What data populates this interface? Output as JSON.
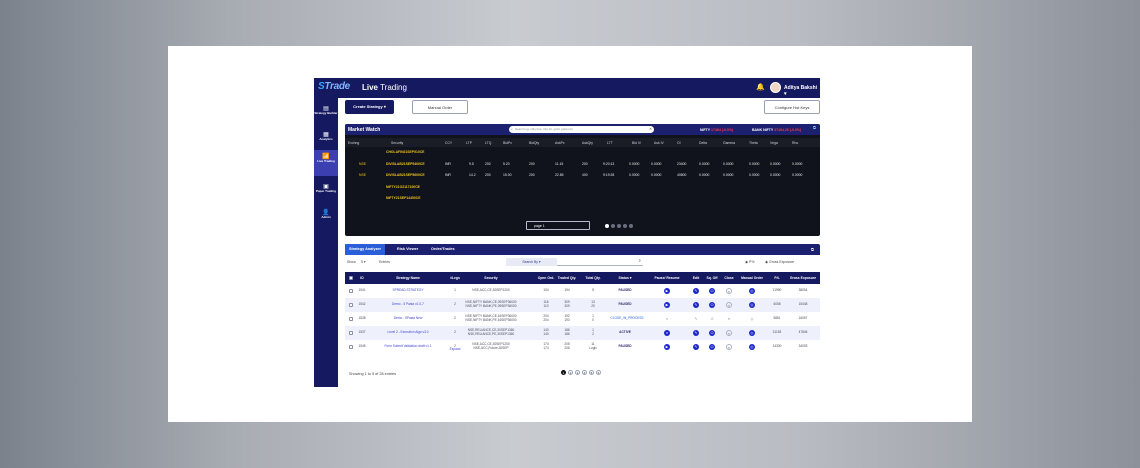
{
  "brand": {
    "logo_prefix": "S",
    "logo_rest": "Trade"
  },
  "header": {
    "title_bold": "Live",
    "title_rest": " Trading",
    "user_name": "Aditya Bakshi ▾"
  },
  "sidebar": {
    "items": [
      {
        "label": "Strategy Builder",
        "icon": "strategy-icon",
        "active": false
      },
      {
        "label": "Analytics",
        "icon": "analytics-icon",
        "active": false
      },
      {
        "label": "Live Trading",
        "icon": "live-trading-icon",
        "active": true
      },
      {
        "label": "Paper Trading",
        "icon": "paper-trading-icon",
        "active": false
      },
      {
        "label": "Admin",
        "icon": "admin-icon",
        "active": false
      }
    ]
  },
  "toolbar": {
    "create_strategy": "Create Strategy ▾",
    "manual_order": "Manual Order",
    "configure_hot_keys": "Configure Hot Keys"
  },
  "market_watch": {
    "title": "Market Watch",
    "search_placeholder": "Search eg: nifty bnk, infy fut, gold, gold mcx",
    "nifty_label": "NIFTY",
    "nifty_value": "17464 (-0.0%)",
    "banknifty_label": "BANK NIFTY",
    "banknifty_value": "37454.25 (-0.0%)",
    "columns": [
      "Exchng",
      "Security",
      "CCY",
      "LTP",
      "LTQ",
      "BidPx",
      "BidQty",
      "AskPx",
      "AskQty",
      "LTT",
      "Bid IV",
      "Ask IV",
      "OI",
      "Delta",
      "Gamma",
      "Theta",
      "Vega",
      "Rho"
    ],
    "rows": [
      {
        "exch": "",
        "security": "CHOLAFIN21SEP510CE",
        "vals": []
      },
      {
        "exch": "NSE",
        "security": "DIVISLAB21SEP5400CE",
        "vals": [
          "INR",
          "9.5",
          "200",
          "5.20",
          "200",
          "11.15",
          "200",
          "9:20:13",
          "0.0000",
          "0.0000",
          "23400",
          "0.0000",
          "0.0000",
          "0.0000",
          "0.0000",
          "0.0000"
        ]
      },
      {
        "exch": "NSE",
        "security": "DIVISLAB21SEP5600CE",
        "vals": [
          "INR",
          "14.2",
          "200",
          "15.00",
          "200",
          "22.85",
          "400",
          "9:19:28",
          "0.0000",
          "0.0000",
          "40800",
          "0.0000",
          "0.0000",
          "0.0000",
          "0.0000",
          "0.0000"
        ]
      },
      {
        "exch": "",
        "security": "NIFTY21O2117100CE",
        "vals": []
      },
      {
        "exch": "",
        "security": "NIFTY21SEP14450CE",
        "vals": []
      }
    ],
    "page_label": "page 1"
  },
  "strategy_analyzer": {
    "tabs": [
      "Strategy Analyzer",
      "Risk Viewer",
      "Order/Trades"
    ],
    "show_label": "Show",
    "show_value": "5 ▾",
    "entries_label": "Entries",
    "search_by": "Search By ▾",
    "pnl_label": "P%",
    "gross_label": "Gross Exposure",
    "columns": [
      "ID",
      "Strategy Name",
      "#Legs",
      "Security",
      "Open Ord.",
      "Traded Qty.",
      "Total Qty.",
      "Status",
      "Pause/ Resume",
      "Edit",
      "Sq. Off",
      "Close",
      "Manual Order",
      "P/L",
      "Gross Exposure"
    ],
    "rows": [
      {
        "id": "1541",
        "name": "SPREAD STRATEGY",
        "legs": "1",
        "legs_extra": "",
        "security": "NSE,ACC,CE,30SEP1200",
        "open": "104",
        "traded": "194",
        "total": "5",
        "status": "PAUSED",
        "pl": "11990",
        "gross": "38054"
      },
      {
        "id": "1542",
        "name": "Demo - 5 Pasta v1.0-7",
        "legs": "2",
        "legs_extra": "",
        "security": "NSE,NIFTY BANK,CE,09SEP36000\nNSE,NIFTY BANK,PE,09SEP36000",
        "open": "116\n110",
        "traded": "309\n309",
        "total": "13\n20",
        "status": "PAUSED",
        "pl": "6058",
        "gross": "15448"
      },
      {
        "id": "1538",
        "name": "Demo - 5Pasta New",
        "legs": "2",
        "legs_extra": "",
        "security": "NSE,NIFTY BANK,CE,16SEP36000\nNSE,NIFTY BANK,PE,16SEP36000",
        "open": "204\n204",
        "traded": "192\n193",
        "total": "1\n0",
        "status": "CLOSE_IN_PROCESS",
        "pl": "5861",
        "gross": "16057"
      },
      {
        "id": "1537",
        "name": "Level 2 - Execution Algo v3.0",
        "legs": "2",
        "legs_extra": "",
        "security": "NSE,RELIANCE,CE,30SEP1360\nNSE,RELIANCE,PE,30SEP1360",
        "open": "140\n140",
        "traded": "186\n186",
        "total": "1\n2",
        "status": "ACTIVE",
        "pl": "31153",
        "gross": "47846"
      },
      {
        "id": "1545",
        "name": "Form Submit Validation draft v1.1",
        "legs": "2",
        "legs_extra": "Expand",
        "security": "NSE,ACC,CE,30SEP1200\nNSE,ACC,Future,30SEP",
        "open": "174\n174",
        "traded": "205\n205",
        "total": "11\nLogic",
        "status": "PAUSED",
        "pl": "14330",
        "gross": "34093"
      }
    ],
    "footer": "Showing 1 to 5 of 28 entries",
    "pages": [
      "1",
      "2",
      "3",
      "4",
      "5",
      "6"
    ]
  }
}
